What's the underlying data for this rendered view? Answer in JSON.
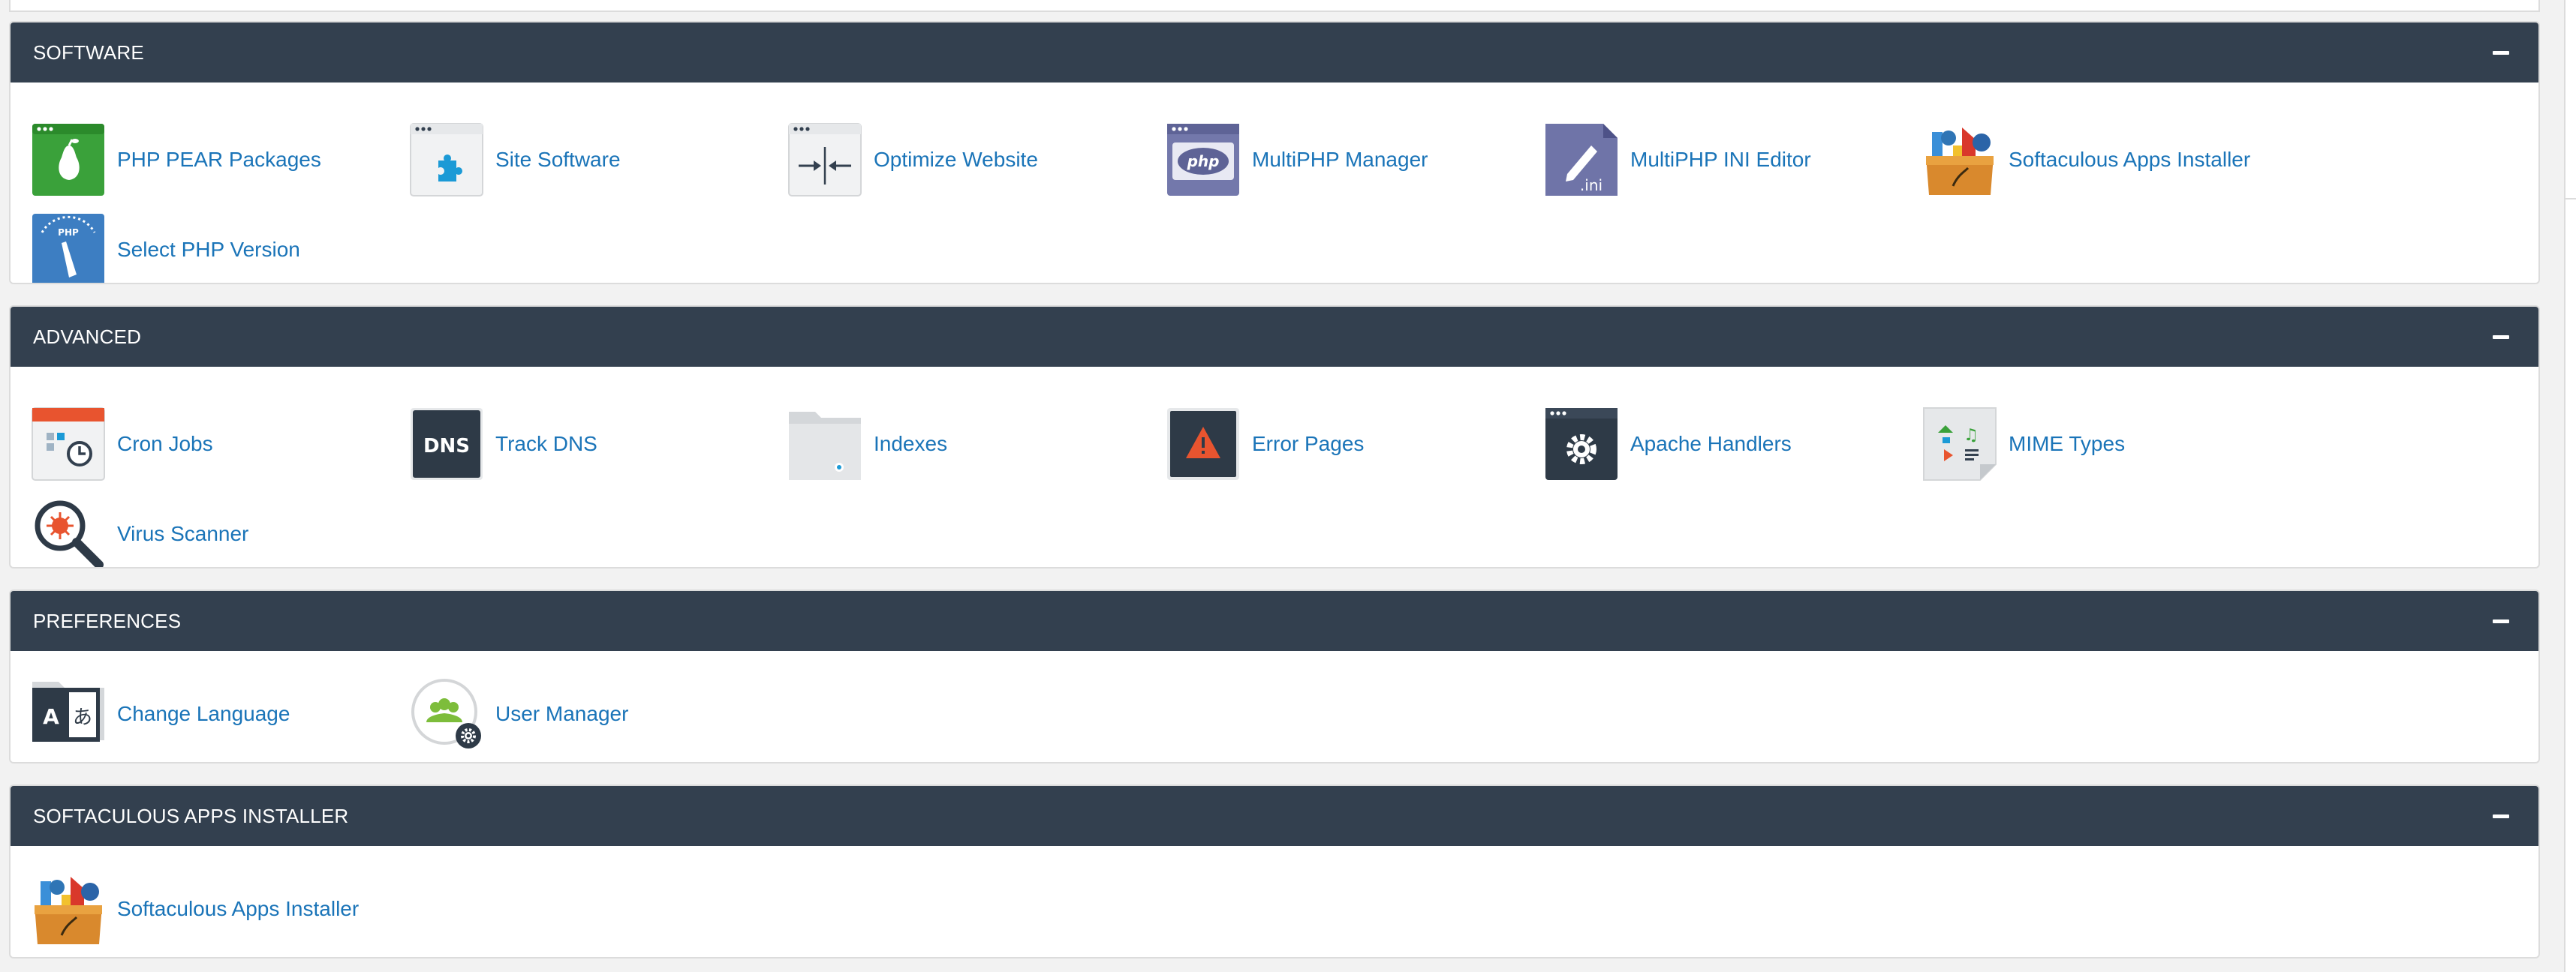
{
  "sections": [
    {
      "title": "SOFTWARE",
      "items": [
        {
          "label": "PHP PEAR Packages",
          "icon": "php-pear-icon"
        },
        {
          "label": "Site Software",
          "icon": "site-software-icon"
        },
        {
          "label": "Optimize Website",
          "icon": "optimize-website-icon"
        },
        {
          "label": "MultiPHP Manager",
          "icon": "multiphp-manager-icon"
        },
        {
          "label": "MultiPHP INI Editor",
          "icon": "ini-editor-icon"
        },
        {
          "label": "Softaculous Apps Installer",
          "icon": "softaculous-icon"
        },
        {
          "label": "Select PHP Version",
          "icon": "select-php-version-icon"
        }
      ]
    },
    {
      "title": "ADVANCED",
      "items": [
        {
          "label": "Cron Jobs",
          "icon": "cron-jobs-icon"
        },
        {
          "label": "Track DNS",
          "icon": "track-dns-icon"
        },
        {
          "label": "Indexes",
          "icon": "indexes-folder-icon"
        },
        {
          "label": "Error Pages",
          "icon": "error-pages-icon"
        },
        {
          "label": "Apache Handlers",
          "icon": "apache-handlers-gear-icon"
        },
        {
          "label": "MIME Types",
          "icon": "mime-types-icon"
        },
        {
          "label": "Virus Scanner",
          "icon": "virus-scanner-icon"
        }
      ]
    },
    {
      "title": "PREFERENCES",
      "items": [
        {
          "label": "Change Language",
          "icon": "change-language-icon"
        },
        {
          "label": "User Manager",
          "icon": "user-manager-icon"
        }
      ]
    },
    {
      "title": "SOFTACULOUS APPS INSTALLER",
      "items": [
        {
          "label": "Softaculous Apps Installer",
          "icon": "softaculous-icon"
        }
      ]
    }
  ],
  "icon_text": {
    "php": "php",
    "ini": ".ini",
    "dns": "DNS",
    "lang_a": "A",
    "lang_b": "あ",
    "pear_php": "PHP"
  },
  "colors": {
    "header_bg": "#33404f",
    "link": "#1a74b8",
    "page_bg": "#f2f2f2"
  }
}
